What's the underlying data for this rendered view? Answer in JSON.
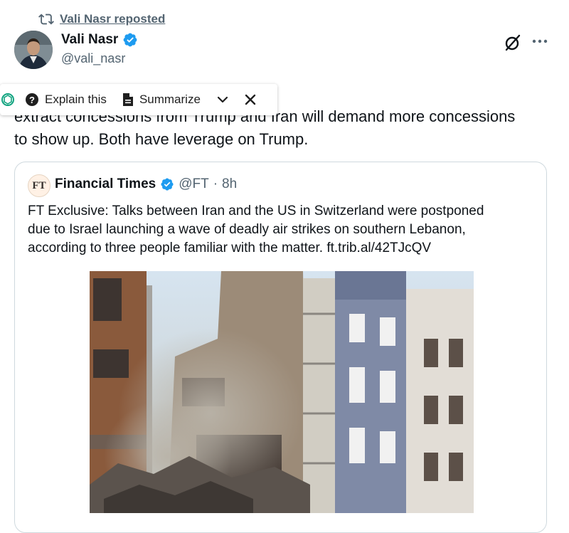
{
  "repost": {
    "text": "Vali Nasr reposted"
  },
  "author": {
    "name": "Vali Nasr",
    "handle": "@vali_nasr"
  },
  "tweet": {
    "text": "ng the talks Israel will now try to\nextract concessions from Trump and Iran will demand more concessions\nto show up. Both have leverage on Trump."
  },
  "ai_toolbar": {
    "explain_label": "Explain this",
    "summarize_label": "Summarize"
  },
  "quote": {
    "source_logo": "FT",
    "name": "Financial Times",
    "handle": "@FT",
    "dot": "·",
    "time": "8h",
    "text": "FT Exclusive: Talks between Iran and the US in Switzerland were postponed\ndue to Israel launching a wave of deadly air strikes on southern Lebanon,\naccording to three people familiar with the matter. ft.trib.al/42TJcQV"
  },
  "icons": {
    "repost": "repost-icon",
    "verified": "verified-badge-icon",
    "grok": "grok-icon",
    "more": "more-icon",
    "chatgpt": "chatgpt-icon",
    "help": "question-icon",
    "document": "document-icon",
    "chevron": "chevron-down-icon",
    "close": "close-icon"
  },
  "colors": {
    "verified": "#1d9bf0",
    "secondary_text": "#536471",
    "chatgpt": "#10a37f",
    "ft_background": "#fff1e5"
  }
}
